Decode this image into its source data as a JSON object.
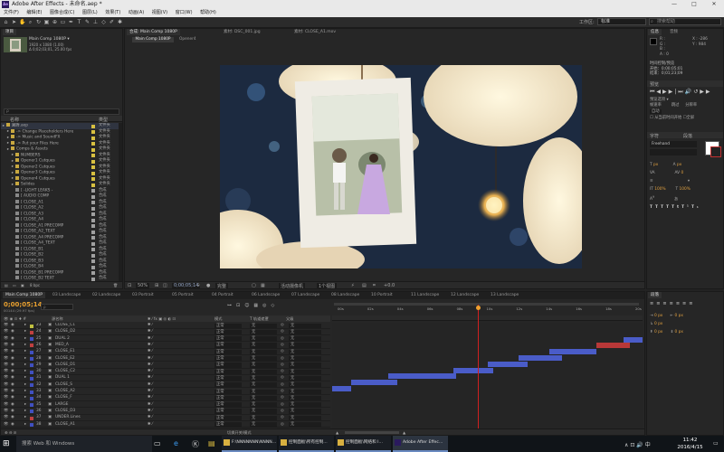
{
  "window": {
    "title": "Adobe After Effects - 未命名.aep *",
    "min": "—",
    "max": "□",
    "close": "✕"
  },
  "menu": [
    "文件(F)",
    "编辑(E)",
    "图像合成(C)",
    "图层(L)",
    "效果(T)",
    "动画(A)",
    "视图(V)",
    "窗口(W)",
    "帮助(H)"
  ],
  "toolbar": {
    "workspace_label": "工作区:",
    "workspace_value": "标准",
    "search_placeholder": "搜索帮助"
  },
  "project": {
    "tab": "项目",
    "comp_name": "Main Comp 1080P ▾",
    "comp_info1": "1920 x 1080 (1.00)",
    "comp_info2": "Δ 0;02;03;01, 25.00 fps",
    "search_placeholder": "ρ",
    "col_name": "名称",
    "col_type": "类型",
    "items": [
      {
        "name": "翼腾.aep",
        "type": "文件夹",
        "kind": "folder",
        "indent": 0
      },
      {
        "name": "-> Change Placeholders Here",
        "type": "文件夹",
        "kind": "folder",
        "indent": 1
      },
      {
        "name": "-> Music and SoundFX",
        "type": "文件夹",
        "kind": "folder",
        "indent": 1
      },
      {
        "name": "-> Put your Files Here",
        "type": "文件夹",
        "kind": "folder",
        "indent": 1
      },
      {
        "name": "Comps & Assets",
        "type": "文件夹",
        "kind": "folder",
        "indent": 1
      },
      {
        "name": "NUMBERS",
        "type": "文件夹",
        "kind": "folder",
        "indent": 2
      },
      {
        "name": "Opener1 Cutques",
        "type": "文件夹",
        "kind": "folder",
        "indent": 2
      },
      {
        "name": "Opener2 Cutques",
        "type": "文件夹",
        "kind": "folder",
        "indent": 2
      },
      {
        "name": "Opener3 Cutques",
        "type": "文件夹",
        "kind": "folder",
        "indent": 2
      },
      {
        "name": "Opener4 Cutques",
        "type": "文件夹",
        "kind": "folder",
        "indent": 2
      },
      {
        "name": "Solides",
        "type": "文件夹",
        "kind": "folder",
        "indent": 2
      },
      {
        "name": "[ -LIGHT LEAKS -",
        "type": "合成",
        "kind": "comp",
        "indent": 2
      },
      {
        "name": "[ AUDIO COMP",
        "type": "合成",
        "kind": "comp",
        "indent": 2
      },
      {
        "name": "[ CLOSE_A1",
        "type": "合成",
        "kind": "comp",
        "indent": 2
      },
      {
        "name": "[ CLOSE_A2",
        "type": "合成",
        "kind": "comp",
        "indent": 2
      },
      {
        "name": "[ CLOSE_A3",
        "type": "合成",
        "kind": "comp",
        "indent": 2
      },
      {
        "name": "[ CLOSE_A4",
        "type": "合成",
        "kind": "comp",
        "indent": 2
      },
      {
        "name": "[ CLOSE_A1 PRECOMP",
        "type": "合成",
        "kind": "comp",
        "indent": 2
      },
      {
        "name": "[ CLOSE_A2_TEXT",
        "type": "合成",
        "kind": "comp",
        "indent": 2
      },
      {
        "name": "[ CLOSE_A4 PRECOMP",
        "type": "合成",
        "kind": "comp",
        "indent": 2
      },
      {
        "name": "[ CLOSE_A4_TEXT",
        "type": "合成",
        "kind": "comp",
        "indent": 2
      },
      {
        "name": "[ CLOSE_B1",
        "type": "合成",
        "kind": "comp",
        "indent": 2
      },
      {
        "name": "[ CLOSE_B2",
        "type": "合成",
        "kind": "comp",
        "indent": 2
      },
      {
        "name": "[ CLOSE_B3",
        "type": "合成",
        "kind": "comp",
        "indent": 2
      },
      {
        "name": "[ CLOSE_B4",
        "type": "合成",
        "kind": "comp",
        "indent": 2
      },
      {
        "name": "[ CLOSE_B1 PRECOMP",
        "type": "合成",
        "kind": "comp",
        "indent": 2
      },
      {
        "name": "[ CLOSE_B2 TEXT",
        "type": "合成",
        "kind": "comp",
        "indent": 2
      }
    ],
    "footer": "8 bpc"
  },
  "viewer": {
    "tabs": [
      "合成: Main Comp 1080P",
      "素材: DSC_001.jpg",
      "素材: CLOSE_A1.mov"
    ],
    "breadcrumb": [
      "Main Comp 1080P",
      "Opener4"
    ],
    "zoom": "50%",
    "timecode": "0;00;05;14",
    "resolution": "完整",
    "camera": "活动摄像机",
    "views": "1个视图",
    "exposure": "+0.0"
  },
  "info": {
    "tab_info": "信息",
    "tab_audio": "音频",
    "r": "R :",
    "g": "G :",
    "b": "B :",
    "a": "A : 0",
    "x": "X : -286",
    "y": "Y : 984",
    "preview_header": "时间控制/预览",
    "preview_start": "开始：0;00;05;01",
    "preview_end": "结束：0;01;23;09",
    "preview_panel": "预览",
    "options1": "预览选项 ▾",
    "frame_rate": "帧速率",
    "skip": "跳过",
    "resolution": "分辨率",
    "auto": "自动",
    "from_current": "从当前时间开始",
    "fullscreen": "全屏",
    "char_tab": "字符",
    "para_tab": "段落",
    "font": "Freehand",
    "px1": "px",
    "px2": "px",
    "pct1": "100%",
    "pct2": "100%",
    "tracking": "0"
  },
  "timeline": {
    "tabs": [
      "Main Comp 1080P",
      "03 Landscape",
      "02 Landscape",
      "03 Portrait",
      "05 Portrait",
      "04 Portrait",
      "06 Landscape",
      "07 Landscape",
      "08 Landscape",
      "10 Portrait",
      "11 Landscape",
      "12 Landscape",
      "13 Landscape"
    ],
    "timecode": "0;00;05;14",
    "fps_info": "00144 (29.97 fps)",
    "col_label": "源名称",
    "col_mode": "模式",
    "col_trkmat": "T 轨道遮罩",
    "col_parent": "父级",
    "mode_value": "正常",
    "trk_value": "无",
    "parent_value": "无",
    "rulers": [
      "00s",
      "02s",
      "04s",
      "06s",
      "08s",
      "10s",
      "12s",
      "14s",
      "16s",
      "18s",
      "20s"
    ],
    "layers": [
      {
        "num": "23",
        "name": "CLOSE_C1",
        "color": "#c0c040"
      },
      {
        "num": "24",
        "name": "CLOSE_D2",
        "color": "#c04040"
      },
      {
        "num": "25",
        "name": "DUAL 2",
        "color": "#4050c0"
      },
      {
        "num": "26",
        "name": "MED_A",
        "color": "#c04040"
      },
      {
        "num": "27",
        "name": "CLOSE_E1",
        "color": "#4050c0"
      },
      {
        "num": "28",
        "name": "CLOSE_E2",
        "color": "#4050c0"
      },
      {
        "num": "29",
        "name": "CLOSE_D1",
        "color": "#4050c0"
      },
      {
        "num": "30",
        "name": "CLOSE_C2",
        "color": "#4050c0"
      },
      {
        "num": "31",
        "name": "DUAL 1",
        "color": "#4050c0"
      },
      {
        "num": "32",
        "name": "CLOSE_S",
        "color": "#4050c0"
      },
      {
        "num": "33",
        "name": "CLOSE_A2",
        "color": "#4050c0"
      },
      {
        "num": "34",
        "name": "CLOSE_F",
        "color": "#4050c0"
      },
      {
        "num": "35",
        "name": "LARGE",
        "color": "#4050c0"
      },
      {
        "num": "36",
        "name": "CLOSE_D3",
        "color": "#4050c0"
      },
      {
        "num": "37",
        "name": "UNDER.Lines",
        "color": "#c04040"
      },
      {
        "num": "38",
        "name": "CLOSE_A1",
        "color": "#4050c0"
      }
    ],
    "bars": [
      {
        "row": 2,
        "start": 0.94,
        "end": 1.0,
        "color": "#4a5cc8"
      },
      {
        "row": 3,
        "start": 0.85,
        "end": 0.96,
        "color": "#b83838"
      },
      {
        "row": 4,
        "start": 0.7,
        "end": 0.85,
        "color": "#4a5cc8"
      },
      {
        "row": 5,
        "start": 0.6,
        "end": 0.74,
        "color": "#4a5cc8"
      },
      {
        "row": 6,
        "start": 0.5,
        "end": 0.63,
        "color": "#4a5cc8"
      },
      {
        "row": 7,
        "start": 0.39,
        "end": 0.52,
        "color": "#4a5cc8"
      },
      {
        "row": 8,
        "start": 0.18,
        "end": 0.4,
        "color": "#4a5cc8"
      },
      {
        "row": 9,
        "start": 0.06,
        "end": 0.21,
        "color": "#4a5cc8"
      },
      {
        "row": 10,
        "start": 0,
        "end": 0.06,
        "color": "#4a5cc8"
      }
    ],
    "playhead": 0.47,
    "footer": "切换开关/模式"
  },
  "paragraph": {
    "tab": "段落",
    "px_rows": [
      "0 px",
      "0 px",
      "0 px",
      "0 px",
      "0 px"
    ]
  },
  "taskbar": {
    "search": "搜索 Web 和 Windows",
    "apps": [
      {
        "label": "F:\\NNNNNNN\\NNNN...",
        "icon": "folder-icon"
      },
      {
        "label": "控制面板\\所有控制...",
        "icon": "folder-icon"
      },
      {
        "label": "控制面板\\网络和 I...",
        "icon": "folder-icon"
      },
      {
        "label": "Adobe After Effec...",
        "icon": "ae-icon"
      }
    ],
    "lang": "中",
    "time": "11:42",
    "date": "2016/4/15"
  }
}
